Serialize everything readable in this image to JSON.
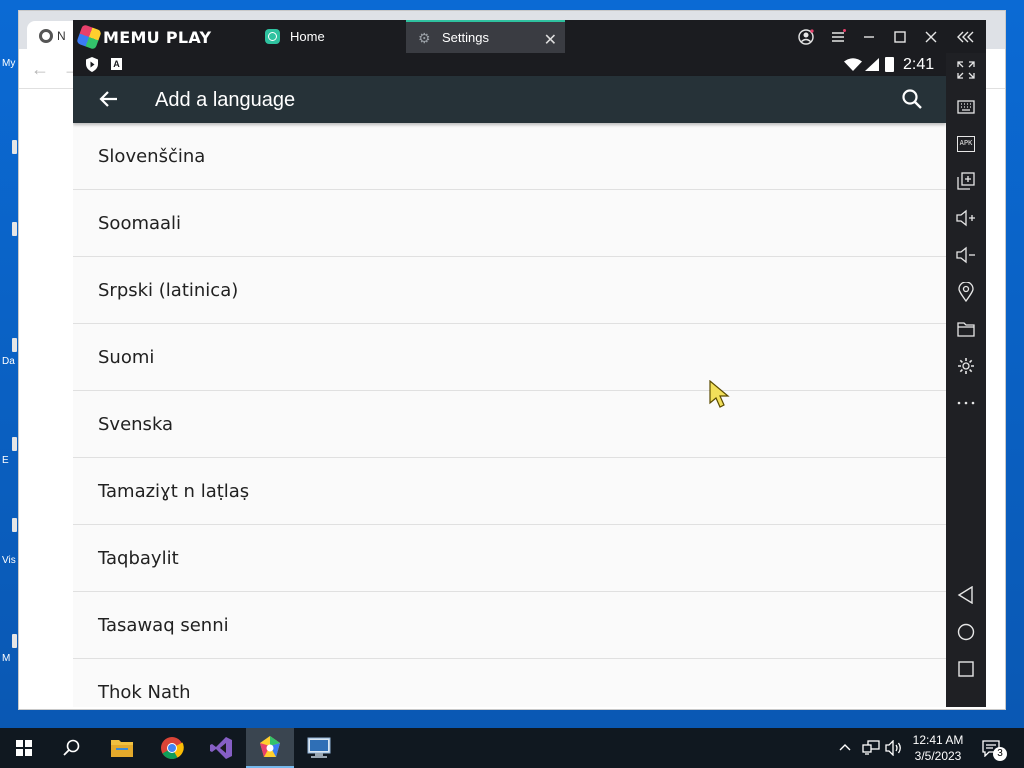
{
  "desktop": {
    "icon_labels": [
      "My",
      "Da",
      "E",
      "Vis",
      "M"
    ]
  },
  "chrome": {
    "tab_title": "N"
  },
  "memu": {
    "brand": "MEMU PLAY",
    "tabs": [
      {
        "label": "Home",
        "icon": "android-app-icon"
      },
      {
        "label": "Settings",
        "icon": "settings-gear-icon"
      }
    ],
    "controls": [
      "account-icon",
      "menu-icon",
      "minimize-icon",
      "maximize-icon",
      "close-icon",
      "collapse-sidebar-icon"
    ],
    "sidebar_buttons": [
      "fullscreen-icon",
      "keyboard-icon",
      "apk-icon",
      "multi-window-icon",
      "volume-up-icon",
      "volume-down-icon",
      "location-icon",
      "folder-icon",
      "settings-icon",
      "more-icon",
      "back-nav-icon",
      "home-nav-icon",
      "recents-nav-icon"
    ],
    "apk_label": "APK"
  },
  "android": {
    "status_time": "2:41",
    "appbar_title": "Add a language",
    "languages": [
      "Slovenščina",
      "Soomaali",
      "Srpski (latinica)",
      "Suomi",
      "Svenska",
      "Tamaziɣt n laṭlaṣ",
      "Taqbaylit",
      "Tasawaq senni",
      "Thok Nath"
    ]
  },
  "taskbar": {
    "apps": [
      "windows-start-icon",
      "search-icon",
      "file-explorer-icon",
      "chrome-icon",
      "visual-studio-icon",
      "memu-icon",
      "remote-desktop-icon"
    ],
    "clock_time": "12:41 AM",
    "clock_date": "3/5/2023",
    "notification_count": "3"
  },
  "colors": {
    "appbar": "#263238",
    "accent_tab": "#2fc2a0",
    "desktop": "#0a63c9"
  }
}
